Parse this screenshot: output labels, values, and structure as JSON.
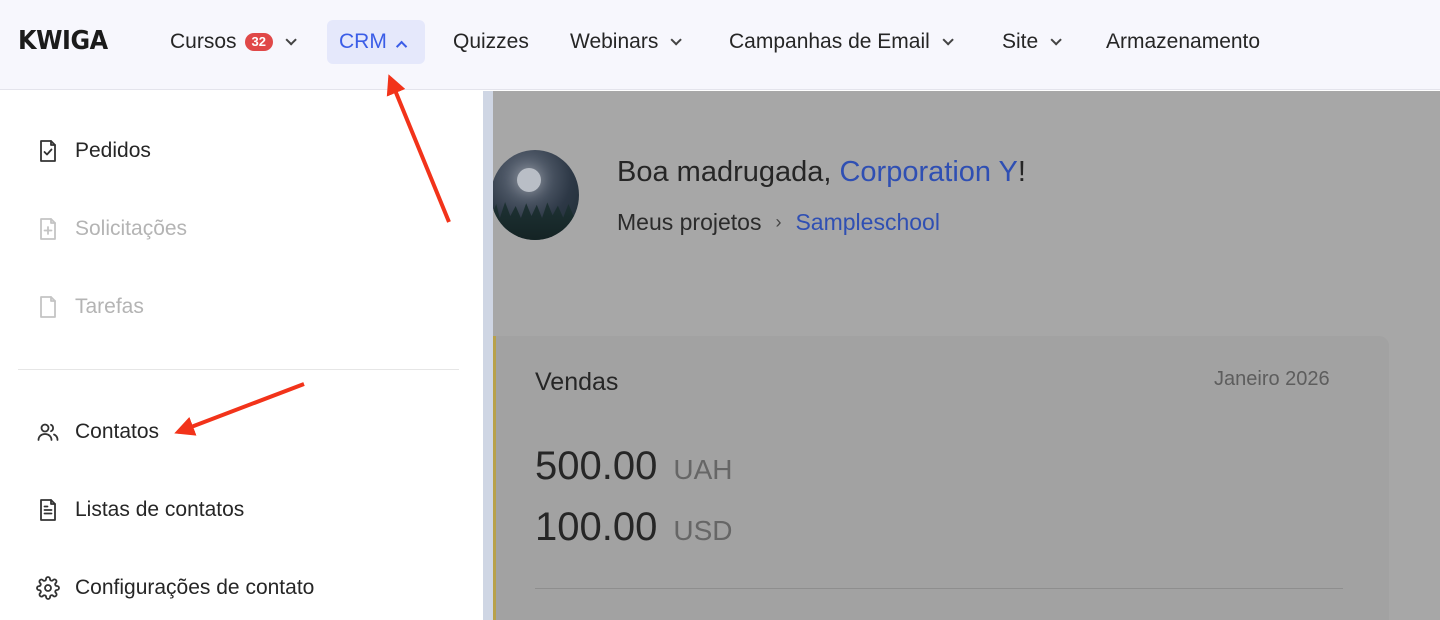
{
  "header": {
    "logo": "KWIGA",
    "nav": {
      "cursos": {
        "label": "Cursos",
        "badge": "32"
      },
      "crm": {
        "label": "CRM"
      },
      "quizzes": {
        "label": "Quizzes"
      },
      "webinars": {
        "label": "Webinars"
      },
      "email": {
        "label": "Campanhas de Email"
      },
      "site": {
        "label": "Site"
      },
      "storage": {
        "label": "Armazenamento"
      }
    }
  },
  "crm_menu": {
    "items": [
      {
        "label": "Pedidos",
        "icon": "order-check-icon",
        "enabled": true
      },
      {
        "label": "Solicitações",
        "icon": "file-plus-icon",
        "enabled": false
      },
      {
        "label": "Tarefas",
        "icon": "file-icon",
        "enabled": false
      },
      {
        "label": "Contatos",
        "icon": "users-icon",
        "enabled": true
      },
      {
        "label": "Listas de contatos",
        "icon": "file-text-icon",
        "enabled": true
      },
      {
        "label": "Configurações de contato",
        "icon": "gear-icon",
        "enabled": true
      }
    ]
  },
  "dashboard": {
    "greeting_prefix": "Boa madrugada, ",
    "user_name": "Corporation Y",
    "greeting_suffix": "!",
    "breadcrumb": {
      "root": "Meus projetos",
      "separator": "›",
      "current": "Sampleschool"
    },
    "sales_card": {
      "title": "Vendas",
      "period": "Janeiro 2026",
      "amounts": [
        {
          "value": "500.00",
          "currency": "UAH"
        },
        {
          "value": "100.00",
          "currency": "USD"
        }
      ]
    }
  },
  "colors": {
    "accent": "#3b5de7",
    "link": "#2f4fb3",
    "badge": "#e04848",
    "annotation_arrow": "#f2331a"
  }
}
